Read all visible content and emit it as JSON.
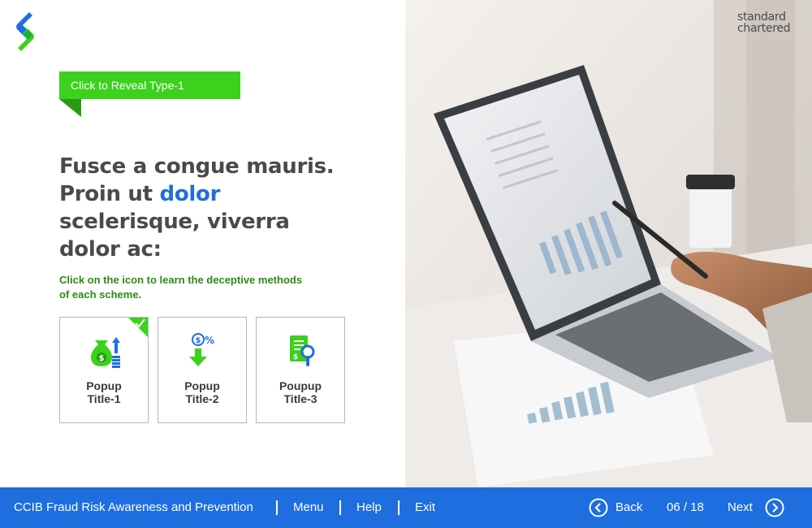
{
  "brand": {
    "name_line1": "standard",
    "name_line2": "chartered"
  },
  "reveal_tab": {
    "label": "Click to Reveal Type-1"
  },
  "heading": {
    "part1": "Fusce a congue mauris. Proin ut ",
    "highlight": "dolor",
    "part2": " scelerisque, viverra dolor ac:"
  },
  "instruction": "Click on the icon to learn the deceptive methods of each scheme.",
  "cards": [
    {
      "line1": "Popup",
      "line2": "Title-1",
      "icon": "money-bag-coins-icon",
      "completed": true
    },
    {
      "line1": "Popup",
      "line2": "Title-2",
      "icon": "dollar-percent-down-icon",
      "completed": false
    },
    {
      "line1": "Poupup",
      "line2": "Title-3",
      "icon": "document-search-icon",
      "completed": false
    }
  ],
  "footer": {
    "course_title": "CCIB Fraud Risk Awareness and Prevention",
    "menu": "Menu",
    "help": "Help",
    "exit": "Exit",
    "back": "Back",
    "page": "06 / 18",
    "next": "Next"
  },
  "colors": {
    "accent_blue": "#1e6ee0",
    "accent_green": "#3bd11c",
    "dark_green": "#2c8a14",
    "text": "#4a4a4a"
  }
}
